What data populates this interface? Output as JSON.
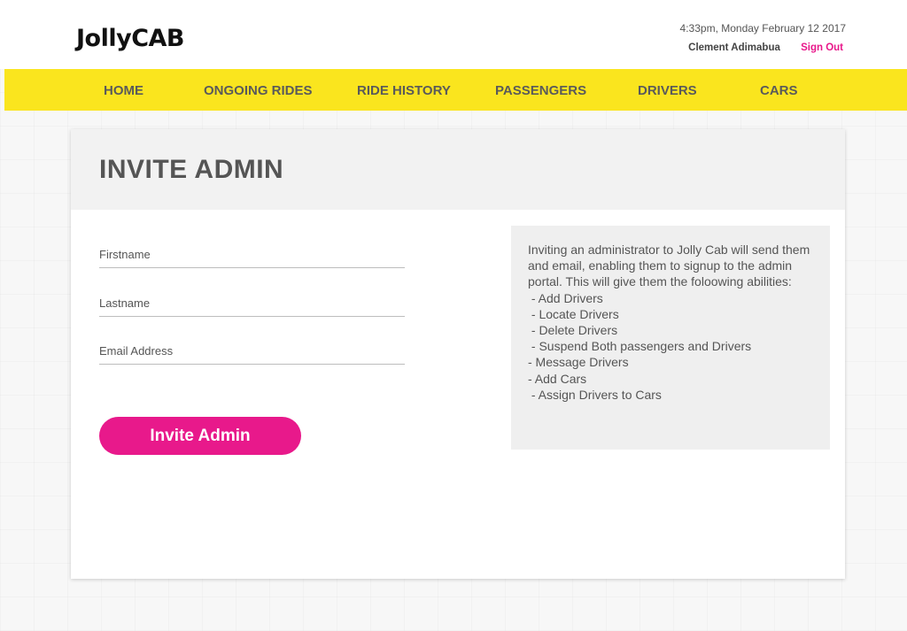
{
  "header": {
    "logo": "JollyCAB",
    "datetime": "4:33pm, Monday February 12 2017",
    "user_name": "Clement Adimabua",
    "sign_out": "Sign Out"
  },
  "nav": {
    "items": [
      {
        "label": "HOME"
      },
      {
        "label": "ONGOING RIDES"
      },
      {
        "label": "RIDE HISTORY"
      },
      {
        "label": "PASSENGERS"
      },
      {
        "label": "DRIVERS"
      },
      {
        "label": "CARS"
      }
    ]
  },
  "page": {
    "title": "INVITE ADMIN"
  },
  "form": {
    "firstname_placeholder": "Firstname",
    "firstname_value": "",
    "lastname_placeholder": "Lastname",
    "lastname_value": "",
    "email_placeholder": "Email Address",
    "email_value": "",
    "submit_label": "Invite Admin"
  },
  "info": {
    "intro": "Inviting an administrator to Jolly Cab will send them and email, enabling them to signup to the admin portal. This will give them the foloowing abilities:",
    "abilities": [
      " - Add Drivers",
      " - Locate Drivers",
      " - Delete Drivers",
      " - Suspend Both passengers and Drivers",
      "- Message Drivers",
      "- Add Cars",
      " - Assign Drivers to Cars"
    ]
  },
  "colors": {
    "accent": "#e8198b",
    "nav_bg": "#fae51e",
    "panel_bg": "#f2f2f2"
  }
}
